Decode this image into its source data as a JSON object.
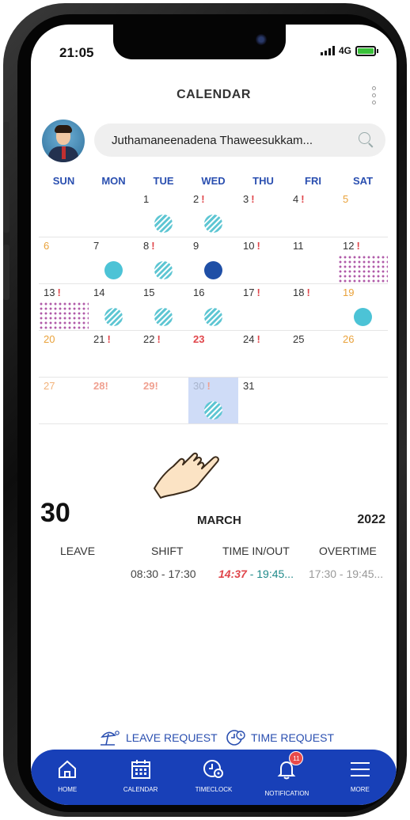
{
  "status_bar": {
    "time": "21:05",
    "network": "4G"
  },
  "header": {
    "title": "CALENDAR"
  },
  "search": {
    "value": "Juthamaneenadena Thaweesukkam..."
  },
  "calendar": {
    "weekdays": [
      "SUN",
      "MON",
      "TUE",
      "WED",
      "THU",
      "FRI",
      "SAT"
    ],
    "weeks": [
      [
        null,
        null,
        {
          "d": "1",
          "m": "striped"
        },
        {
          "d": "2",
          "flag": "!",
          "m": "striped"
        },
        {
          "d": "3",
          "flag": "!"
        },
        {
          "d": "4",
          "flag": "!"
        },
        {
          "d": "5",
          "k": "weekend"
        }
      ],
      [
        {
          "d": "6",
          "k": "weekend"
        },
        {
          "d": "7",
          "m": "teal"
        },
        {
          "d": "8",
          "flag": "!",
          "m": "striped"
        },
        {
          "d": "9",
          "m": "navy"
        },
        {
          "d": "10",
          "flag": "!"
        },
        {
          "d": "11"
        },
        {
          "d": "12",
          "flag": "!",
          "m": "dots"
        }
      ],
      [
        {
          "d": "13",
          "flag": "!",
          "m": "dots"
        },
        {
          "d": "14",
          "m": "striped"
        },
        {
          "d": "15",
          "m": "striped"
        },
        {
          "d": "16",
          "m": "striped"
        },
        {
          "d": "17",
          "flag": "!"
        },
        {
          "d": "18",
          "flag": "!"
        },
        {
          "d": "19",
          "k": "weekend",
          "m": "teal"
        }
      ],
      [
        {
          "d": "20",
          "k": "weekend"
        },
        {
          "d": "21",
          "flag": "!"
        },
        {
          "d": "22",
          "flag": "!"
        },
        {
          "d": "23",
          "k": "holiday"
        },
        {
          "d": "24",
          "flag": "!"
        },
        {
          "d": "25"
        },
        {
          "d": "26",
          "k": "weekend"
        }
      ],
      [
        {
          "d": "27",
          "k": "past-w"
        },
        {
          "d": "28!",
          "k": "past"
        },
        {
          "d": "29!",
          "k": "past"
        },
        {
          "d": "30",
          "flag": "!",
          "m": "striped",
          "selected": true
        },
        {
          "d": "31"
        },
        null,
        null
      ]
    ]
  },
  "detail": {
    "day": "30",
    "month": "MARCH",
    "year": "2022",
    "columns": [
      "LEAVE",
      "SHIFT",
      "TIME IN/OUT",
      "OVERTIME"
    ],
    "shift": "08:30 - 17:30",
    "time_in": "14:37",
    "time_out": " - 19:45...",
    "overtime": "17:30 - 19:45..."
  },
  "requests": {
    "leave": "LEAVE REQUEST",
    "time": "TIME REQUEST"
  },
  "nav": {
    "home": "HOME",
    "calendar": "CALENDAR",
    "timeclock": "TIMECLOCK",
    "notification": "NOTIFICATION",
    "notification_badge": "11",
    "more": "MORE"
  },
  "colors": {
    "accent": "#1840b8",
    "weekday_header": "#2a4fb0",
    "weekend": "#e9a23b",
    "alert": "#e0464b",
    "selected": "#cfdcf7",
    "time_in": "#e0464b",
    "time_out": "#1f8a8a"
  }
}
